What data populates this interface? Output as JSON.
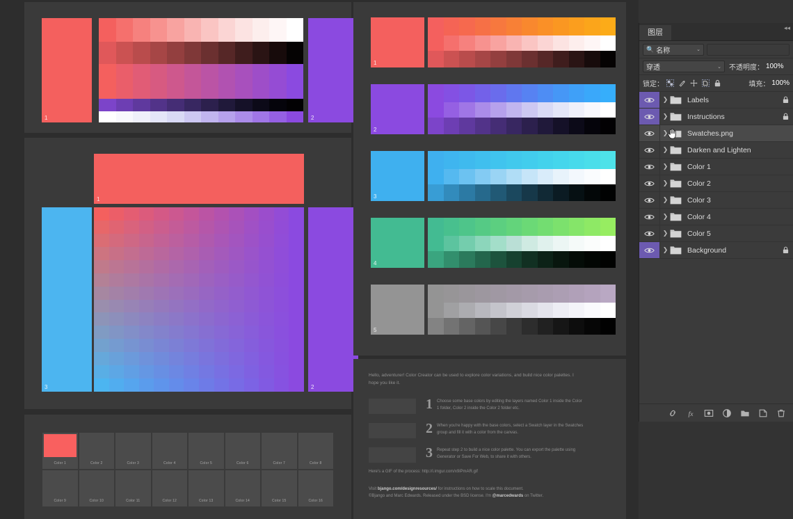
{
  "app": {
    "canvas_bg": "#2d2d2d",
    "panel_bg": "#3a3a3a"
  },
  "artboards": {
    "top_left": {
      "base_left_color": "#f4605e",
      "base_right_color": "#8b4ae0",
      "label_left": "1",
      "label_right": "2"
    },
    "mid_left": {
      "top_color": "#f4605e",
      "left_color": "#4cb5f0",
      "right_color": "#8b4ae0",
      "label_top": "1",
      "label_left": "3",
      "label_right": "2"
    },
    "swatch_grid": {
      "filled_color": "#f9605f",
      "cells": [
        {
          "label": "Color 1",
          "filled": true
        },
        {
          "label": "Color 2",
          "filled": false
        },
        {
          "label": "Color 3",
          "filled": false
        },
        {
          "label": "Color 4",
          "filled": false
        },
        {
          "label": "Color 5",
          "filled": false
        },
        {
          "label": "Color 6",
          "filled": false
        },
        {
          "label": "Color 7",
          "filled": false
        },
        {
          "label": "Color 8",
          "filled": false
        },
        {
          "label": "Color 9",
          "filled": false
        },
        {
          "label": "Color 10",
          "filled": false
        },
        {
          "label": "Color 11",
          "filled": false
        },
        {
          "label": "Color 12",
          "filled": false
        },
        {
          "label": "Color 13",
          "filled": false
        },
        {
          "label": "Color 14",
          "filled": false
        },
        {
          "label": "Color 15",
          "filled": false
        },
        {
          "label": "Color 16",
          "filled": false
        }
      ]
    },
    "strips": [
      {
        "label": "1",
        "base": "#f4605e",
        "hue_ramp": [
          "#f4605e",
          "#f56455",
          "#f6694e",
          "#f67046",
          "#f7783e",
          "#f88036",
          "#f9882e",
          "#fa9027",
          "#fa9722",
          "#fb9e1e",
          "#fba51b",
          "#fcab18"
        ],
        "tint_ramp": [
          "#f4605e",
          "#f5706d",
          "#f6817e",
          "#f7928f",
          "#f8a3a0",
          "#f9b4b2",
          "#fac5c3",
          "#fbd5d4",
          "#fce3e2",
          "#fdeeed",
          "#fef6f6",
          "#ffffff"
        ],
        "shade_ramp": [
          "#e0585a",
          "#cb5252",
          "#b94c4c",
          "#a64646",
          "#933f3f",
          "#7f3838",
          "#6b3030",
          "#562727",
          "#3f1d1d",
          "#2a1414",
          "#170b0b",
          "#050303"
        ]
      },
      {
        "label": "2",
        "base": "#8b4ae0",
        "hue_ramp": [
          "#8b4ae0",
          "#8450e3",
          "#7c57e6",
          "#7361e9",
          "#6a6cec",
          "#6077ef",
          "#5782f2",
          "#4e8df4",
          "#4697f6",
          "#3fa0f8",
          "#3aa8fa",
          "#36aefb"
        ],
        "tint_ramp": [
          "#8b4ae0",
          "#9560e3",
          "#a076e6",
          "#ab8ce9",
          "#b6a1ec",
          "#c1b5ef",
          "#cdc8f2",
          "#d9daf5",
          "#e4e6f8",
          "#eff0fa",
          "#f8f8fd",
          "#ffffff"
        ],
        "shade_ramp": [
          "#7c44c9",
          "#6d3eb3",
          "#5f399e",
          "#523389",
          "#452d75",
          "#382761",
          "#2c204d",
          "#20193a",
          "#151128",
          "#0c0a18",
          "#05040b",
          "#020103"
        ]
      },
      {
        "label": "3",
        "base": "#3fb0ef",
        "hue_ramp": [
          "#3fb0ef",
          "#3fb5ef",
          "#3fbaee",
          "#40bfee",
          "#40c4ee",
          "#41c9ed",
          "#42cded",
          "#43d2ec",
          "#45d6ec",
          "#47daeb",
          "#4adeea",
          "#4ee2e9"
        ],
        "tint_ramp": [
          "#3fb0ef",
          "#55b9f0",
          "#6cc2f1",
          "#83cbf3",
          "#9ad4f4",
          "#b0ddf6",
          "#c6e5f8",
          "#d9ecfa",
          "#e8f3fb",
          "#f3f8fd",
          "#fafcfe",
          "#ffffff"
        ],
        "shade_ramp": [
          "#389dd5",
          "#328bbc",
          "#2c7aa4",
          "#26698c",
          "#215975",
          "#1b485e",
          "#163849",
          "#112935",
          "#0b1b23",
          "#061013",
          "#030708",
          "#010202"
        ]
      },
      {
        "label": "4",
        "base": "#43bb92",
        "hue_ramp": [
          "#43bb92",
          "#48c08e",
          "#4ec58a",
          "#55ca85",
          "#5ccf80",
          "#63d47b",
          "#6bd976",
          "#73dd71",
          "#7ce16d",
          "#85e569",
          "#8ee965",
          "#97ed61"
        ],
        "tint_ramp": [
          "#43bb92",
          "#5cc49f",
          "#74cdad",
          "#8cd6bb",
          "#a3dec9",
          "#badfd6",
          "#cfeae2",
          "#e0f1ed",
          "#ecf6f4",
          "#f5faf9",
          "#fbfdfc",
          "#ffffff"
        ],
        "shade_ramp": [
          "#3aa57f",
          "#328f6d",
          "#2b7a5c",
          "#23664c",
          "#1d533d",
          "#16412f",
          "#113022",
          "#0c2217",
          "#08160e",
          "#040c07",
          "#020603",
          "#010201"
        ]
      },
      {
        "label": "5",
        "base": "#949494",
        "hue_ramp": [
          "#949494",
          "#979597",
          "#9a969b",
          "#9d979f",
          "#a098a3",
          "#a399a7",
          "#a69bab",
          "#a99caf",
          "#ac9eb3",
          "#b0a0b8",
          "#b4a3bd",
          "#b9a8c3"
        ],
        "tint_ramp": [
          "#949494",
          "#a0a0a2",
          "#acacb0",
          "#b8b8be",
          "#c4c4cb",
          "#d0d0d7",
          "#dadae2",
          "#e4e4ec",
          "#ededf4",
          "#f4f4f9",
          "#fafafd",
          "#ffffff"
        ],
        "shade_ramp": [
          "#838383",
          "#737373",
          "#646464",
          "#555555",
          "#474747",
          "#3a3a3a",
          "#2d2d2d",
          "#212121",
          "#161616",
          "#0d0d0d",
          "#060606",
          "#010101"
        ]
      }
    ],
    "instructions": {
      "intro": "Hello, adventurer! Color Creator can be used to explore color variations, and build nice color palettes. I hope you like it.",
      "steps": [
        {
          "num": "1",
          "text": "Choose some base colors by editing the layers named Color 1 inside the Color 1 folder, Color 2 inside the Color 2 folder etc."
        },
        {
          "num": "2",
          "text": "When you're happy with the base colors, select a Swatch layer in the Swatches group and fill it with a color from the canvas."
        },
        {
          "num": "3",
          "text": "Repeat step 2 to build a nice color palette. You can export the palette using Generator or Save For Web, to share it with others."
        }
      ],
      "gif_prefix": "Here's a GIF of the process: ",
      "gif_url": "http://i.imgur.com/x9iPmAR.gif",
      "footer_line1_prefix": "Visit ",
      "footer_line1_link": "bjango.com/designresources/",
      "footer_line1_suffix": " for instructions on how to scale this document.",
      "footer_line2_prefix": "©Bjango and Marc Edwards. Released under the BSD license. I'm ",
      "footer_line2_link": "@marcedwards",
      "footer_line2_suffix": " on Twitter."
    }
  },
  "layers_panel": {
    "tab_label": "图层",
    "collapse_icon": "chevron-left-icon",
    "filter": {
      "search_icon": "search-icon",
      "kind_label": "名称",
      "chevron": "⌄"
    },
    "blend": {
      "mode": "穿透",
      "chevron": "⌄",
      "opacity_label": "不透明度：",
      "opacity_value": "100%"
    },
    "lock": {
      "label": "锁定：",
      "icons": [
        "transparent-pixels-lock-icon",
        "image-pixels-lock-icon",
        "position-lock-icon",
        "artboard-nesting-lock-icon",
        "lock-all-icon"
      ],
      "fill_label": "填充：",
      "fill_value": "100%"
    },
    "layers": [
      {
        "name": "Labels",
        "visible": true,
        "locked": true,
        "eye_highlight": true,
        "selected": false
      },
      {
        "name": "Instructions",
        "visible": true,
        "locked": true,
        "eye_highlight": true,
        "selected": false
      },
      {
        "name": "Swatches.png",
        "visible": true,
        "locked": false,
        "eye_highlight": false,
        "selected": true,
        "cursor": true
      },
      {
        "name": "Darken and Lighten",
        "visible": true,
        "locked": false,
        "eye_highlight": false,
        "selected": false
      },
      {
        "name": "Color 1",
        "visible": true,
        "locked": false,
        "eye_highlight": false,
        "selected": false
      },
      {
        "name": "Color 2",
        "visible": true,
        "locked": false,
        "eye_highlight": false,
        "selected": false
      },
      {
        "name": "Color 3",
        "visible": true,
        "locked": false,
        "eye_highlight": false,
        "selected": false
      },
      {
        "name": "Color 4",
        "visible": true,
        "locked": false,
        "eye_highlight": false,
        "selected": false
      },
      {
        "name": "Color 5",
        "visible": true,
        "locked": false,
        "eye_highlight": false,
        "selected": false
      },
      {
        "name": "Background",
        "visible": true,
        "locked": true,
        "eye_highlight": true,
        "selected": false
      }
    ],
    "bottom_icons": [
      "link-layers-icon",
      "layer-style-fx-icon",
      "layer-mask-icon",
      "adjustment-layer-icon",
      "new-group-icon",
      "new-layer-icon",
      "delete-layer-icon"
    ]
  }
}
